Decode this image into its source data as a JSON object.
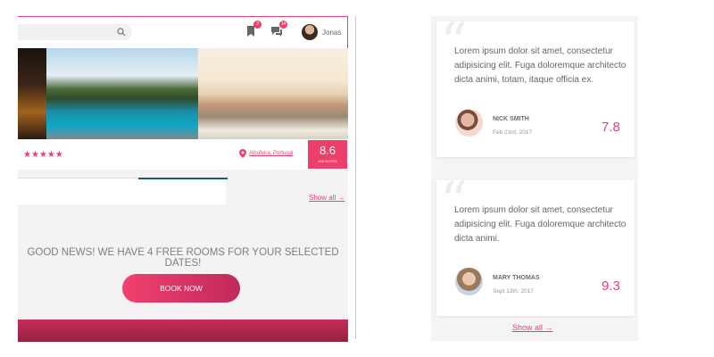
{
  "header": {
    "user_name": "Jonas",
    "badges": {
      "bookmarks": "2",
      "messages": "14"
    }
  },
  "listing": {
    "stars": "★★★★★",
    "location": "Albufeira, Portugal",
    "rating": "8.6",
    "votes": "439 VOTES",
    "show_all": "Show all →"
  },
  "availability": {
    "message": "GOOD NEWS! WE HAVE 4 FREE ROOMS FOR YOUR SELECTED DATES!",
    "book_label": "BOOK NOW"
  },
  "reviews": [
    {
      "text": "Lorem ipsum dolor sit amet, consectetur adipisicing elit. Fuga doloremque architecto dicta animi, totam, itaque officia ex.",
      "name": "NICK SMITH",
      "date": "Feb 23rd, 2017",
      "score": "7.8"
    },
    {
      "text": "Lorem ipsum dolor sit amet, consectetur adipisicing elit. Fuga doloremque architecto dicta animi.",
      "name": "MARY THOMAS",
      "date": "Sept 13th, 2017",
      "score": "9.3"
    }
  ],
  "reviews_show_all": "Show all →",
  "colors": {
    "accent": "#ec3f6a",
    "tab_active": "#1f5f60"
  },
  "icons": [
    "search-icon",
    "bookmark-icon",
    "chat-icon",
    "map-pin-icon",
    "quote-icon"
  ]
}
